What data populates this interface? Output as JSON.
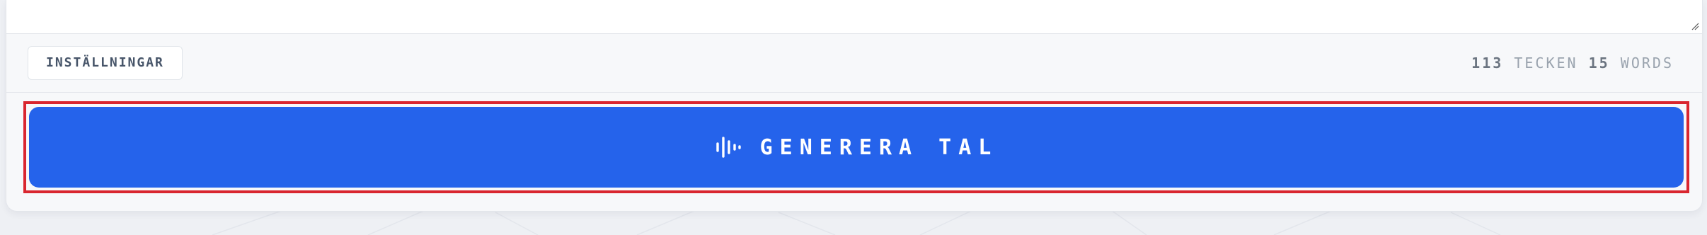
{
  "toolbar": {
    "settings_label": "INSTÄLLNINGAR",
    "char_count": "113",
    "char_unit": "TECKEN",
    "word_count": "15",
    "word_unit": "WORDS"
  },
  "generate": {
    "label": "GENERERA TAL",
    "icon": "audio-waveform-icon"
  },
  "colors": {
    "accent": "#2563eb",
    "highlight_border": "#d9262f"
  }
}
